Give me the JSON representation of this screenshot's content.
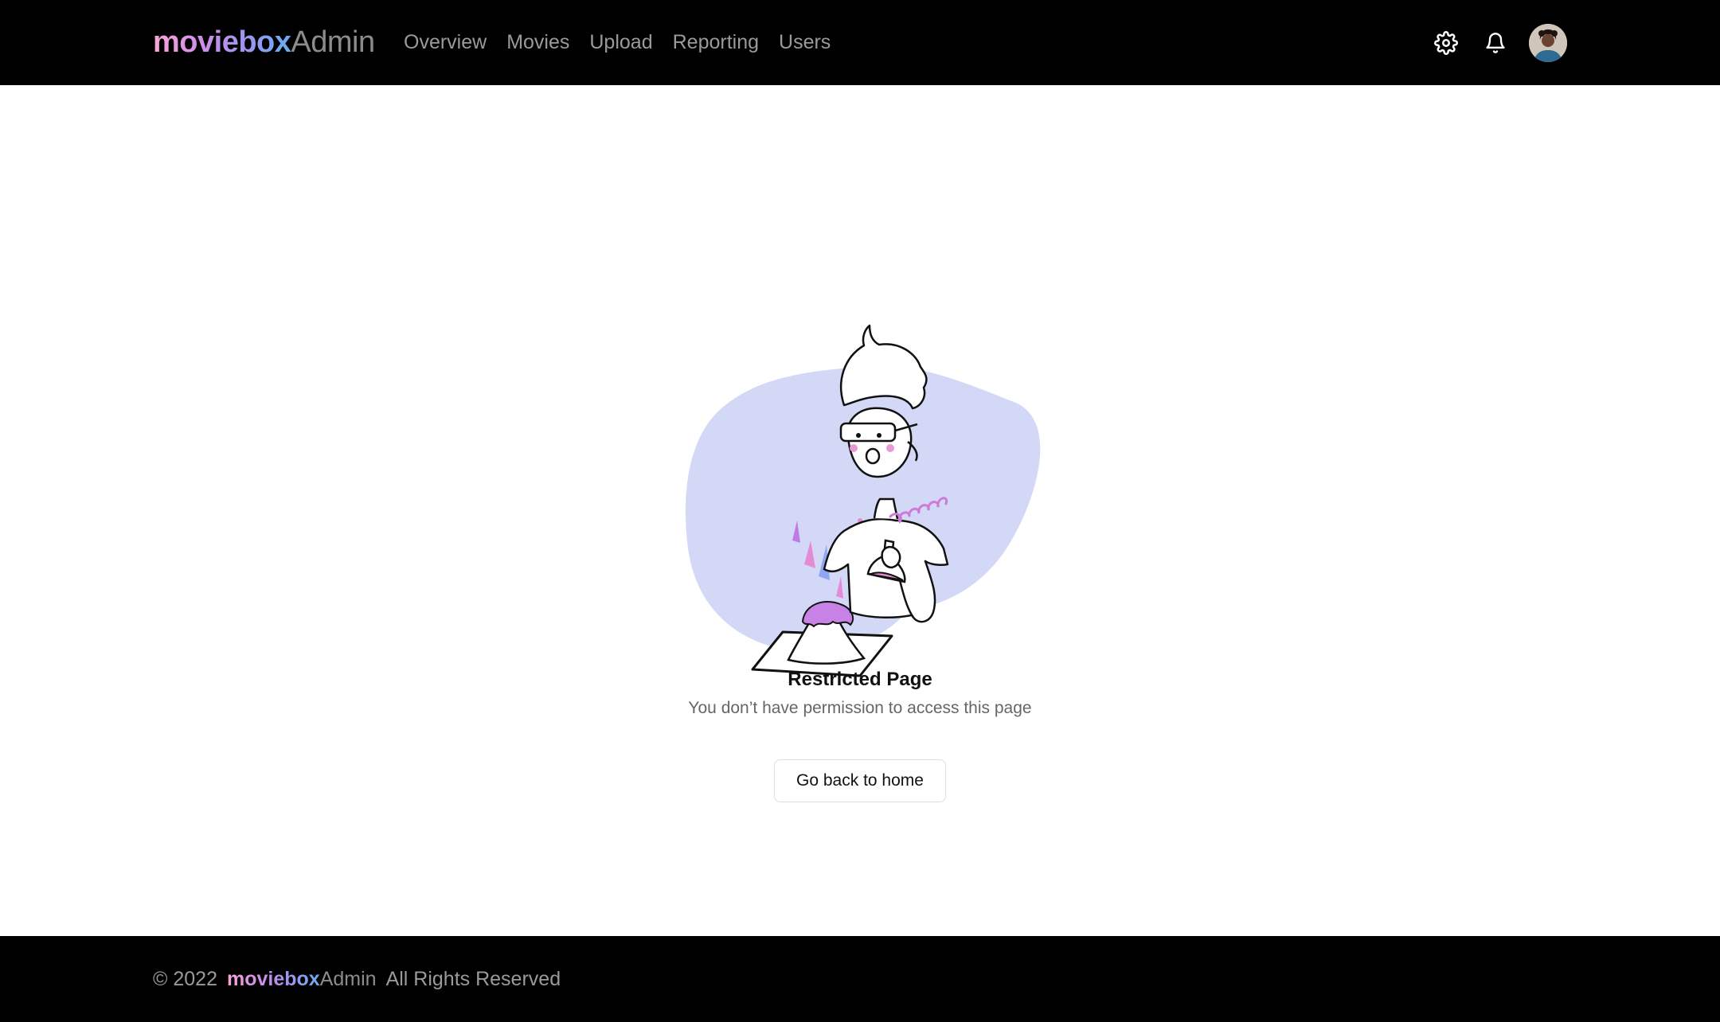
{
  "brand": {
    "bold": "moviebox",
    "light": "Admin"
  },
  "nav": {
    "items": [
      {
        "label": "Overview"
      },
      {
        "label": "Movies"
      },
      {
        "label": "Upload"
      },
      {
        "label": "Reporting"
      },
      {
        "label": "Users"
      }
    ]
  },
  "header": {
    "icons": [
      "gear-icon",
      "bell-icon"
    ],
    "avatar": "user-avatar"
  },
  "content": {
    "title": "Restricted Page",
    "message": "You don’t have permission to access this page",
    "button_label": "Go back to home"
  },
  "footer": {
    "copyright": "© 2022",
    "brand_bold": "moviebox",
    "brand_light": "Admin",
    "rights": "All Rights Reserved"
  },
  "colors": {
    "header_bg": "#000000",
    "blob": "#d3d8f6",
    "brand_gradient": [
      "#f7a6d8",
      "#a193ee",
      "#66aef2"
    ],
    "nav_text": "#9a9a9a"
  }
}
